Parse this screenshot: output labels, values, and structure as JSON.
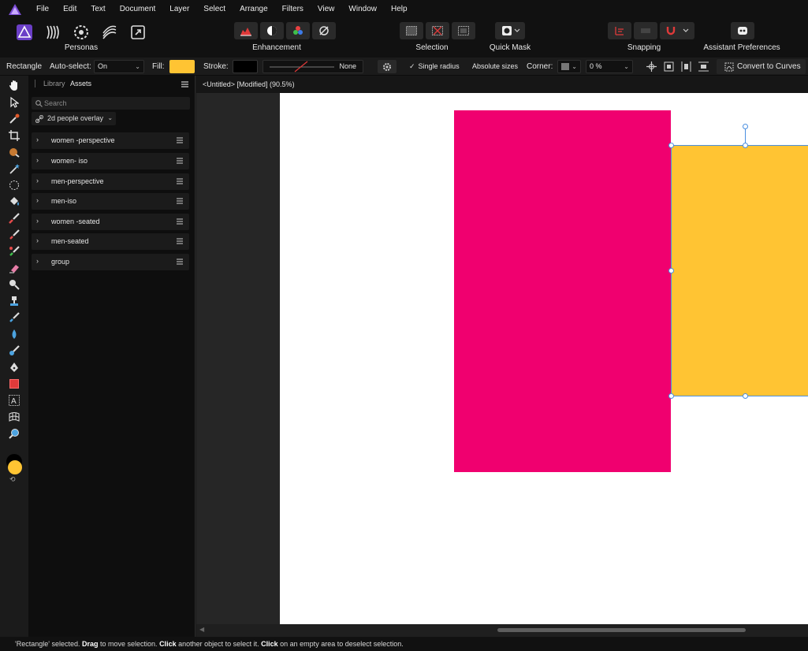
{
  "menu": [
    "File",
    "Edit",
    "Text",
    "Document",
    "Layer",
    "Select",
    "Arrange",
    "Filters",
    "View",
    "Window",
    "Help"
  ],
  "toolbar": {
    "personas_label": "Personas",
    "enhancement_label": "Enhancement",
    "selection_label": "Selection",
    "quick_mask_label": "Quick Mask",
    "snapping_label": "Snapping",
    "assistant_label": "Assistant Preferences"
  },
  "context": {
    "tool_name": "Rectangle",
    "autoselect_label": "Auto-select:",
    "autoselect_value": "On",
    "fill_label": "Fill:",
    "fill_color": "#ffc433",
    "stroke_label": "Stroke:",
    "stroke_color": "#000000",
    "stroke_style_value": "None",
    "single_radius_label": "Single radius",
    "absolute_sizes_label": "Absolute sizes",
    "corner_label": "Corner:",
    "corner_value": "0 %",
    "convert_label": "Convert to Curves"
  },
  "panel": {
    "tab_library": "Library",
    "tab_assets": "Assets",
    "search_placeholder": "Search",
    "category": "2d people overlay",
    "items": [
      "women -perspective",
      "women- iso",
      "men-perspective",
      "men-iso",
      "women -seated",
      "men-seated",
      "group"
    ]
  },
  "document": {
    "title": "<Untitled> [Modified] (90.5%)",
    "shape_colors": {
      "pink": "#f0006f",
      "yellow": "#ffc433"
    }
  },
  "colors": {
    "primary_swatch": "#ffc433",
    "secondary_swatch": "#000000",
    "selection_accent": "#4a8fe0"
  },
  "status": {
    "part1": "'Rectangle' selected. ",
    "drag": "Drag",
    "part2": " to move selection. ",
    "click1": "Click",
    "part3": " another object to select it. ",
    "click2": "Click",
    "part4": " on an empty area to deselect selection."
  }
}
